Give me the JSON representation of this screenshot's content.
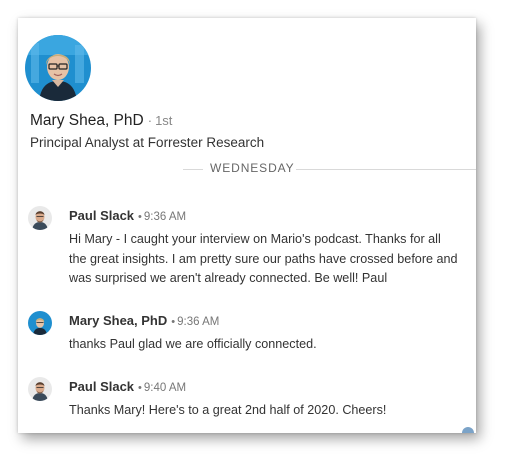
{
  "profile": {
    "name": "Mary Shea, PhD",
    "separator": "·",
    "degree": "1st",
    "headline": "Principal Analyst at Forrester Research"
  },
  "divider": {
    "label": "WEDNESDAY"
  },
  "messages": [
    {
      "sender": "Paul Slack",
      "separator": "•",
      "time": "9:36 AM",
      "text": "Hi Mary - I caught your interview on Mario's podcast. Thanks for all the great insights. I am pretty sure our paths have crossed before and was surprised we aren't already connected. Be well! Paul"
    },
    {
      "sender": "Mary Shea, PhD",
      "separator": "•",
      "time": "9:36 AM",
      "text": "thanks Paul glad we are officially connected."
    },
    {
      "sender": "Paul Slack",
      "separator": "•",
      "time": "9:40 AM",
      "text": "Thanks Mary! Here's to a great 2nd half of 2020. Cheers!"
    }
  ],
  "colors": {
    "mary_avatar_bg": "#1f8fcf",
    "paul_avatar_bg": "#e9e9e9",
    "divider_line": "#d9d9d9"
  }
}
